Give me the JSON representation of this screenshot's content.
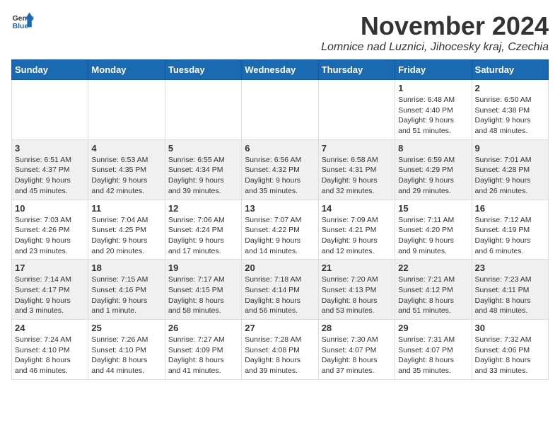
{
  "logo": {
    "line1": "General",
    "line2": "Blue"
  },
  "title": "November 2024",
  "location": "Lomnice nad Luznici, Jihocesky kraj, Czechia",
  "days_of_week": [
    "Sunday",
    "Monday",
    "Tuesday",
    "Wednesday",
    "Thursday",
    "Friday",
    "Saturday"
  ],
  "weeks": [
    [
      {
        "day": "",
        "info": ""
      },
      {
        "day": "",
        "info": ""
      },
      {
        "day": "",
        "info": ""
      },
      {
        "day": "",
        "info": ""
      },
      {
        "day": "",
        "info": ""
      },
      {
        "day": "1",
        "info": "Sunrise: 6:48 AM\nSunset: 4:40 PM\nDaylight: 9 hours\nand 51 minutes."
      },
      {
        "day": "2",
        "info": "Sunrise: 6:50 AM\nSunset: 4:38 PM\nDaylight: 9 hours\nand 48 minutes."
      }
    ],
    [
      {
        "day": "3",
        "info": "Sunrise: 6:51 AM\nSunset: 4:37 PM\nDaylight: 9 hours\nand 45 minutes."
      },
      {
        "day": "4",
        "info": "Sunrise: 6:53 AM\nSunset: 4:35 PM\nDaylight: 9 hours\nand 42 minutes."
      },
      {
        "day": "5",
        "info": "Sunrise: 6:55 AM\nSunset: 4:34 PM\nDaylight: 9 hours\nand 39 minutes."
      },
      {
        "day": "6",
        "info": "Sunrise: 6:56 AM\nSunset: 4:32 PM\nDaylight: 9 hours\nand 35 minutes."
      },
      {
        "day": "7",
        "info": "Sunrise: 6:58 AM\nSunset: 4:31 PM\nDaylight: 9 hours\nand 32 minutes."
      },
      {
        "day": "8",
        "info": "Sunrise: 6:59 AM\nSunset: 4:29 PM\nDaylight: 9 hours\nand 29 minutes."
      },
      {
        "day": "9",
        "info": "Sunrise: 7:01 AM\nSunset: 4:28 PM\nDaylight: 9 hours\nand 26 minutes."
      }
    ],
    [
      {
        "day": "10",
        "info": "Sunrise: 7:03 AM\nSunset: 4:26 PM\nDaylight: 9 hours\nand 23 minutes."
      },
      {
        "day": "11",
        "info": "Sunrise: 7:04 AM\nSunset: 4:25 PM\nDaylight: 9 hours\nand 20 minutes."
      },
      {
        "day": "12",
        "info": "Sunrise: 7:06 AM\nSunset: 4:24 PM\nDaylight: 9 hours\nand 17 minutes."
      },
      {
        "day": "13",
        "info": "Sunrise: 7:07 AM\nSunset: 4:22 PM\nDaylight: 9 hours\nand 14 minutes."
      },
      {
        "day": "14",
        "info": "Sunrise: 7:09 AM\nSunset: 4:21 PM\nDaylight: 9 hours\nand 12 minutes."
      },
      {
        "day": "15",
        "info": "Sunrise: 7:11 AM\nSunset: 4:20 PM\nDaylight: 9 hours\nand 9 minutes."
      },
      {
        "day": "16",
        "info": "Sunrise: 7:12 AM\nSunset: 4:19 PM\nDaylight: 9 hours\nand 6 minutes."
      }
    ],
    [
      {
        "day": "17",
        "info": "Sunrise: 7:14 AM\nSunset: 4:17 PM\nDaylight: 9 hours\nand 3 minutes."
      },
      {
        "day": "18",
        "info": "Sunrise: 7:15 AM\nSunset: 4:16 PM\nDaylight: 9 hours\nand 1 minute."
      },
      {
        "day": "19",
        "info": "Sunrise: 7:17 AM\nSunset: 4:15 PM\nDaylight: 8 hours\nand 58 minutes."
      },
      {
        "day": "20",
        "info": "Sunrise: 7:18 AM\nSunset: 4:14 PM\nDaylight: 8 hours\nand 56 minutes."
      },
      {
        "day": "21",
        "info": "Sunrise: 7:20 AM\nSunset: 4:13 PM\nDaylight: 8 hours\nand 53 minutes."
      },
      {
        "day": "22",
        "info": "Sunrise: 7:21 AM\nSunset: 4:12 PM\nDaylight: 8 hours\nand 51 minutes."
      },
      {
        "day": "23",
        "info": "Sunrise: 7:23 AM\nSunset: 4:11 PM\nDaylight: 8 hours\nand 48 minutes."
      }
    ],
    [
      {
        "day": "24",
        "info": "Sunrise: 7:24 AM\nSunset: 4:10 PM\nDaylight: 8 hours\nand 46 minutes."
      },
      {
        "day": "25",
        "info": "Sunrise: 7:26 AM\nSunset: 4:10 PM\nDaylight: 8 hours\nand 44 minutes."
      },
      {
        "day": "26",
        "info": "Sunrise: 7:27 AM\nSunset: 4:09 PM\nDaylight: 8 hours\nand 41 minutes."
      },
      {
        "day": "27",
        "info": "Sunrise: 7:28 AM\nSunset: 4:08 PM\nDaylight: 8 hours\nand 39 minutes."
      },
      {
        "day": "28",
        "info": "Sunrise: 7:30 AM\nSunset: 4:07 PM\nDaylight: 8 hours\nand 37 minutes."
      },
      {
        "day": "29",
        "info": "Sunrise: 7:31 AM\nSunset: 4:07 PM\nDaylight: 8 hours\nand 35 minutes."
      },
      {
        "day": "30",
        "info": "Sunrise: 7:32 AM\nSunset: 4:06 PM\nDaylight: 8 hours\nand 33 minutes."
      }
    ]
  ]
}
